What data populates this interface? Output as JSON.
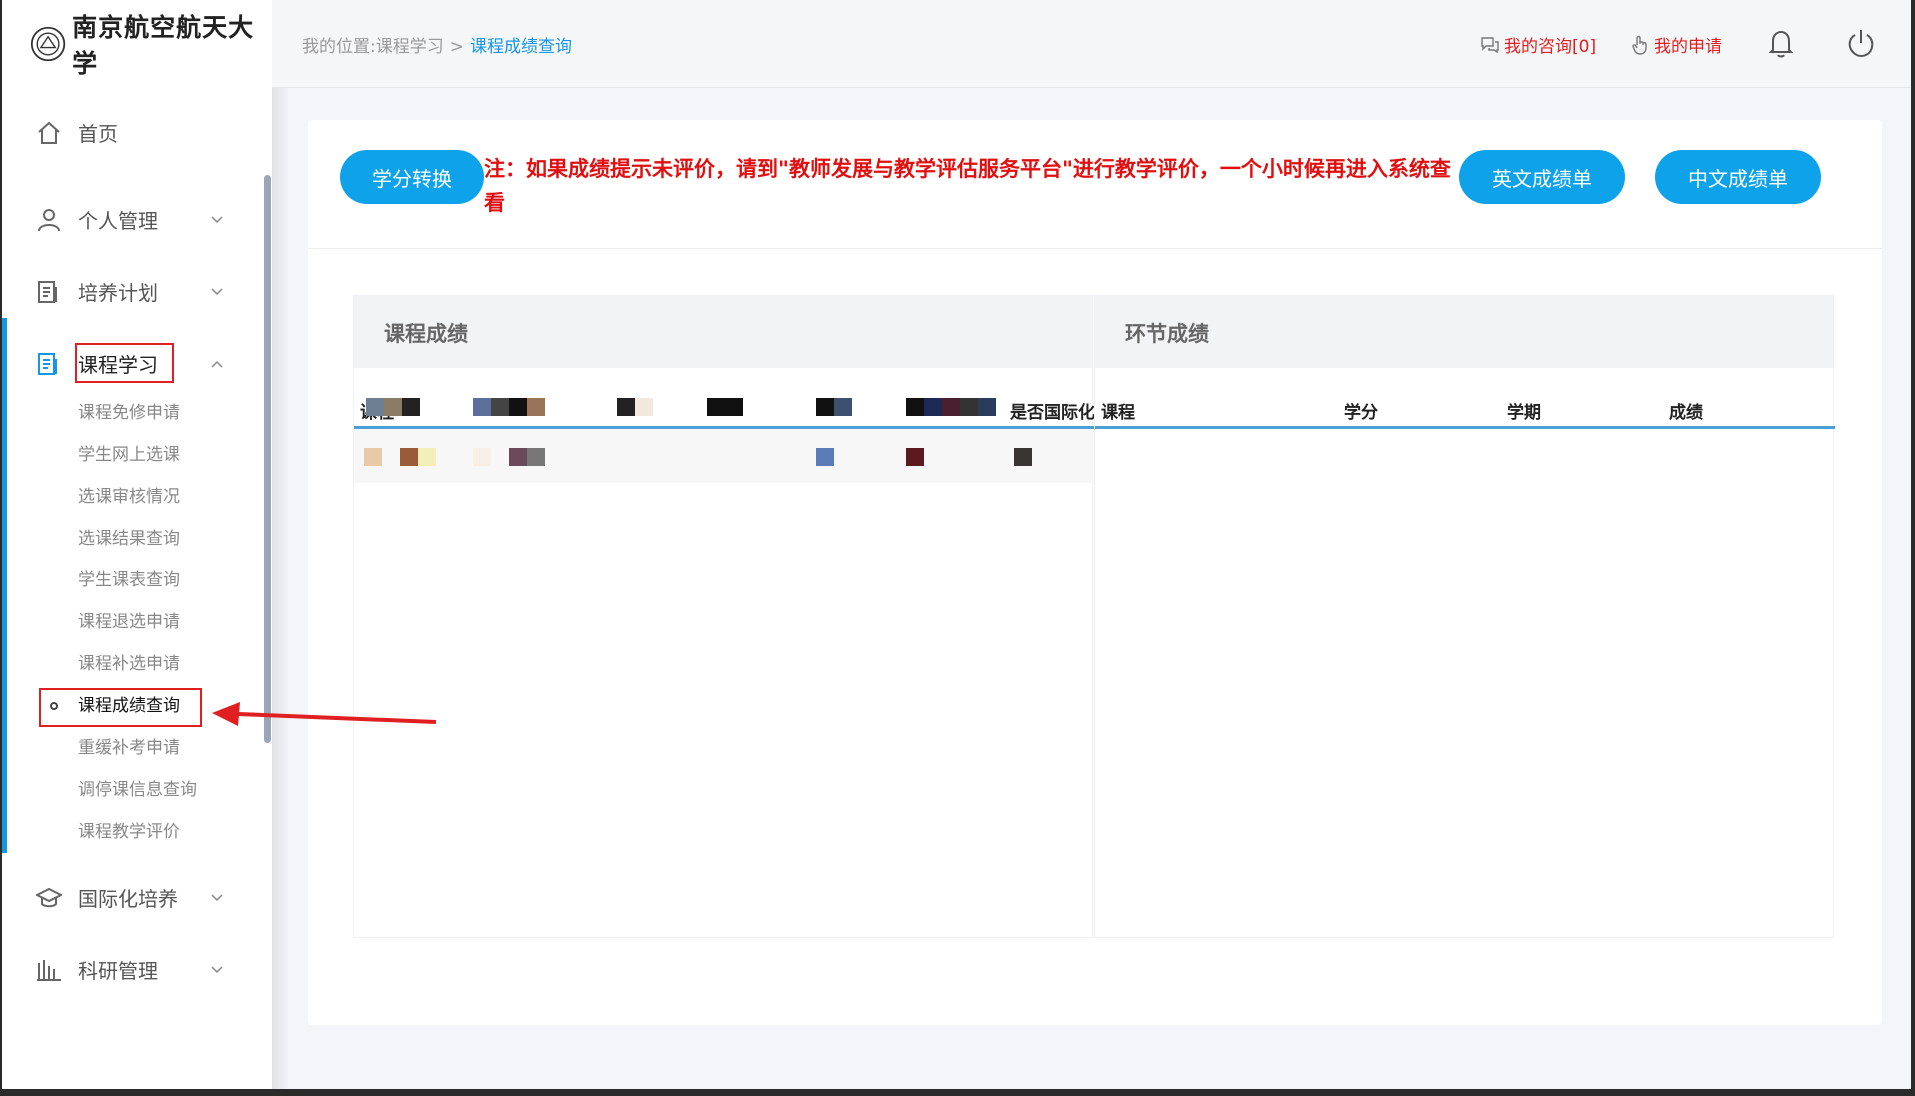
{
  "app": {
    "logo_text": "南京航空航天大学"
  },
  "header": {
    "breadcrumb_prefix": "我的位置:课程学习",
    "breadcrumb_sep": ">",
    "breadcrumb_current": "课程成绩查询",
    "my_consult": "我的咨询[0]",
    "my_apply": "我的申请"
  },
  "sidebar": {
    "items": [
      {
        "label": "首页",
        "icon": "home-icon"
      },
      {
        "label": "个人管理",
        "icon": "user-icon"
      },
      {
        "label": "培养计划",
        "icon": "document-icon"
      },
      {
        "label": "课程学习",
        "icon": "document-icon"
      },
      {
        "label": "国际化培养",
        "icon": "graduation-cap-icon"
      },
      {
        "label": "科研管理",
        "icon": "bar-chart-icon"
      }
    ],
    "sub_items": [
      "课程免修申请",
      "学生网上选课",
      "选课审核情况",
      "选课结果查询",
      "学生课表查询",
      "课程退选申请",
      "课程补选申请",
      "课程成绩查询",
      "重缓补考申请",
      "调停课信息查询",
      "课程教学评价"
    ]
  },
  "content": {
    "credit_convert": "学分转换",
    "notice": "注：如果成绩提示未评价，请到\"教师发展与教学评估服务平台\"进行教学评价，一个小时候再进入系统查看",
    "english_transcript": "英文成绩单",
    "chinese_transcript": "中文成绩单",
    "course_panel": {
      "title": "课程成绩",
      "headers": [
        "课程",
        "是否国际化"
      ]
    },
    "link_panel": {
      "title": "环节成绩",
      "headers": [
        "课程",
        "学分",
        "学期",
        "成绩"
      ]
    }
  },
  "colors": {
    "accent": "#0ea2ea",
    "notice": "#e01010",
    "highlight_box": "#e02020"
  }
}
